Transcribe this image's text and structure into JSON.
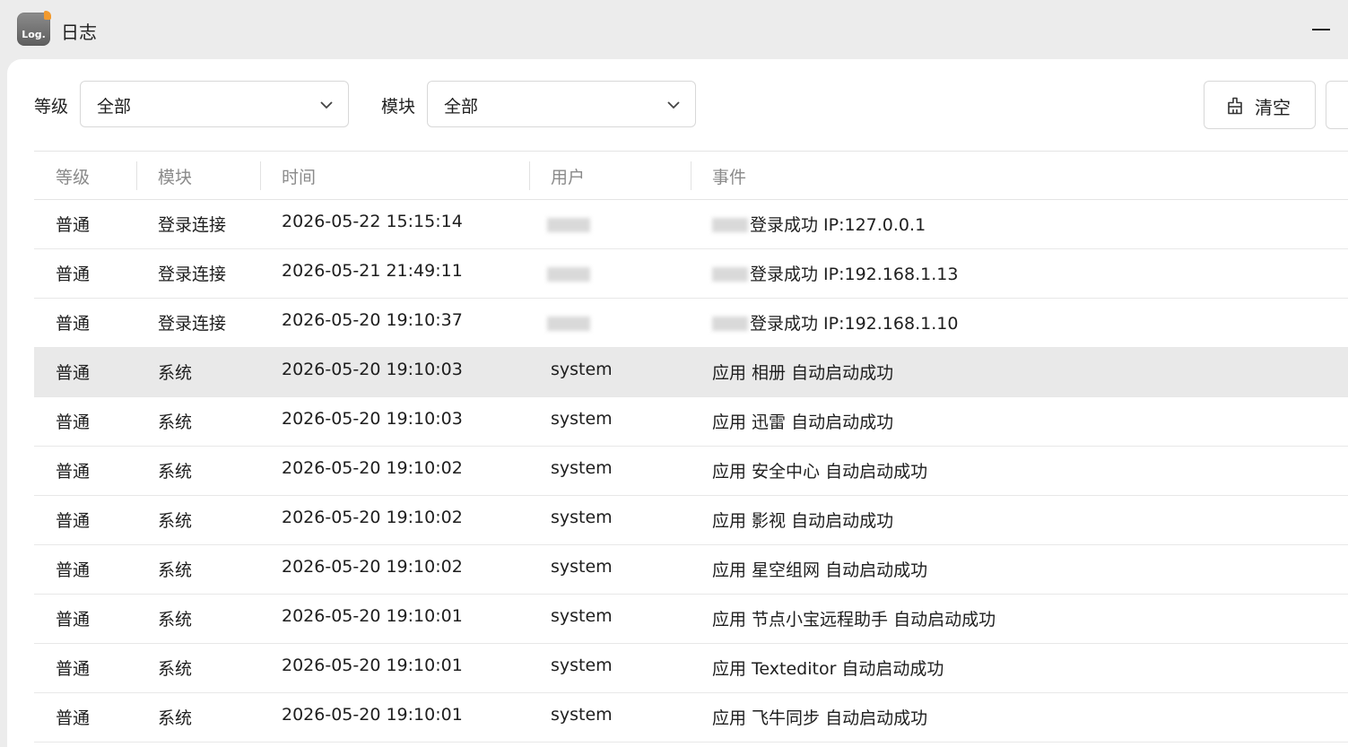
{
  "window": {
    "title": "日志",
    "icon_text": "Log.",
    "icon_accent": "#f29a2e"
  },
  "filters": {
    "level_label": "等级",
    "level_value": "全部",
    "module_label": "模块",
    "module_value": "全部",
    "clear_label": "清空"
  },
  "table": {
    "headers": [
      "等级",
      "模块",
      "时间",
      "用户",
      "事件"
    ],
    "rows": [
      {
        "level": "普通",
        "module": "登录连接",
        "time": "2026-05-22 15:15:14",
        "user": "",
        "event": "登录成功 IP:127.0.0.1",
        "redacted": true
      },
      {
        "level": "普通",
        "module": "登录连接",
        "time": "2026-05-21 21:49:11",
        "user": "",
        "event": "登录成功 IP:192.168.1.13",
        "redacted": true
      },
      {
        "level": "普通",
        "module": "登录连接",
        "time": "2026-05-20 19:10:37",
        "user": "",
        "event": "登录成功 IP:192.168.1.10",
        "redacted": true
      },
      {
        "level": "普通",
        "module": "系统",
        "time": "2026-05-20 19:10:03",
        "user": "system",
        "event": "应用 相册 自动启动成功",
        "selected": true
      },
      {
        "level": "普通",
        "module": "系统",
        "time": "2026-05-20 19:10:03",
        "user": "system",
        "event": "应用 迅雷 自动启动成功"
      },
      {
        "level": "普通",
        "module": "系统",
        "time": "2026-05-20 19:10:02",
        "user": "system",
        "event": "应用 安全中心 自动启动成功"
      },
      {
        "level": "普通",
        "module": "系统",
        "time": "2026-05-20 19:10:02",
        "user": "system",
        "event": "应用 影视 自动启动成功"
      },
      {
        "level": "普通",
        "module": "系统",
        "time": "2026-05-20 19:10:02",
        "user": "system",
        "event": "应用 星空组网 自动启动成功"
      },
      {
        "level": "普通",
        "module": "系统",
        "time": "2026-05-20 19:10:01",
        "user": "system",
        "event": "应用 节点小宝远程助手 自动启动成功"
      },
      {
        "level": "普通",
        "module": "系统",
        "time": "2026-05-20 19:10:01",
        "user": "system",
        "event": "应用 Texteditor 自动启动成功"
      },
      {
        "level": "普通",
        "module": "系统",
        "time": "2026-05-20 19:10:01",
        "user": "system",
        "event": "应用 飞牛同步 自动启动成功"
      }
    ]
  }
}
